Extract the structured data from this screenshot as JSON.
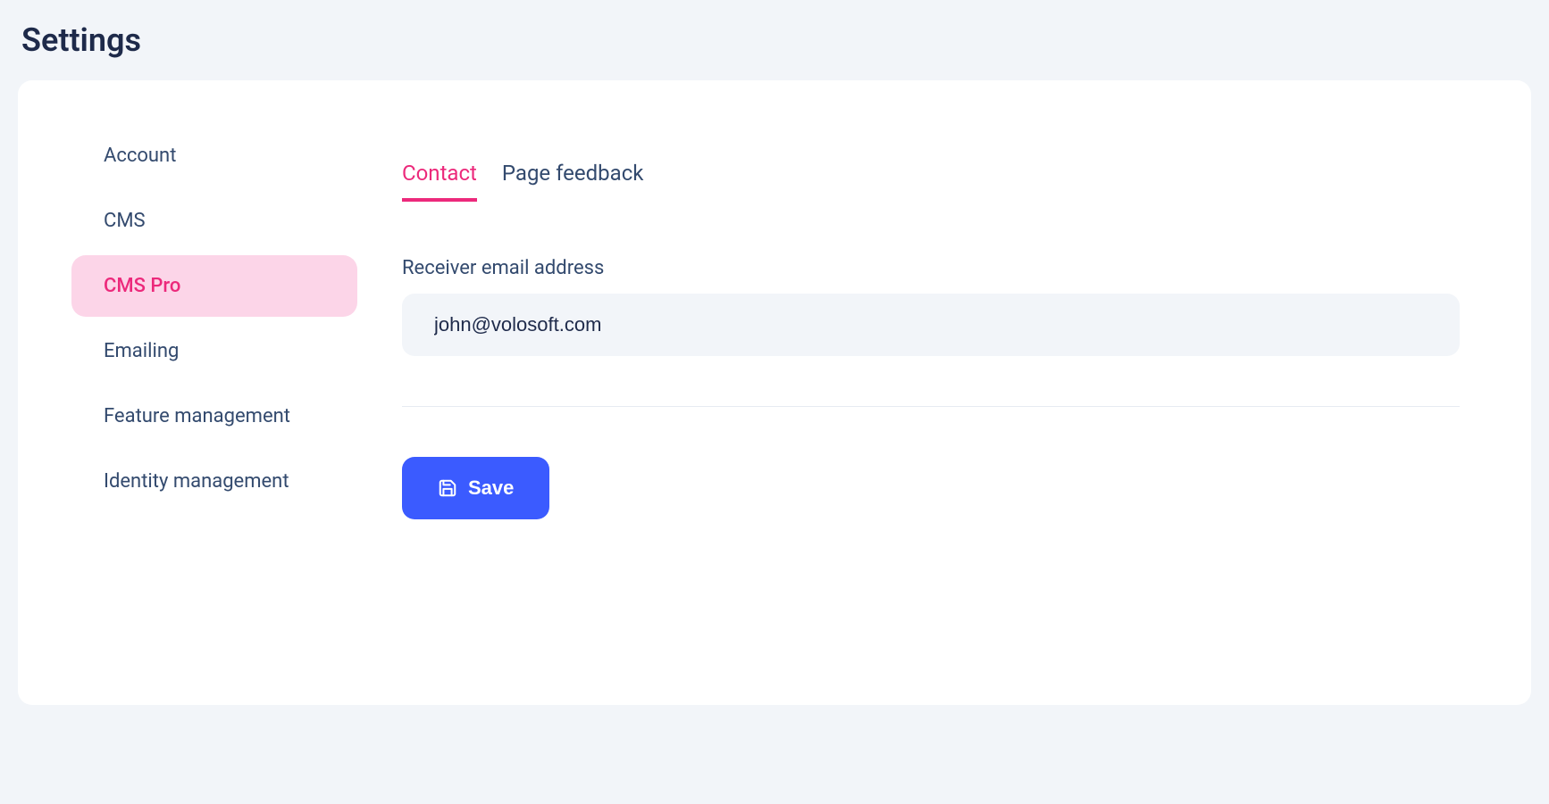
{
  "page": {
    "title": "Settings"
  },
  "sidebar": {
    "items": [
      {
        "label": "Account",
        "name": "sidebar-item-account"
      },
      {
        "label": "CMS",
        "name": "sidebar-item-cms"
      },
      {
        "label": "CMS Pro",
        "name": "sidebar-item-cms-pro"
      },
      {
        "label": "Emailing",
        "name": "sidebar-item-emailing"
      },
      {
        "label": "Feature management",
        "name": "sidebar-item-feature-management"
      },
      {
        "label": "Identity management",
        "name": "sidebar-item-identity-management"
      }
    ],
    "active_index": 2
  },
  "tabs": {
    "items": [
      {
        "label": "Contact",
        "name": "tab-contact"
      },
      {
        "label": "Page feedback",
        "name": "tab-page-feedback"
      }
    ],
    "active_index": 0
  },
  "form": {
    "receiver_email_label": "Receiver email address",
    "receiver_email_value": "john@volosoft.com"
  },
  "actions": {
    "save_label": "Save"
  }
}
